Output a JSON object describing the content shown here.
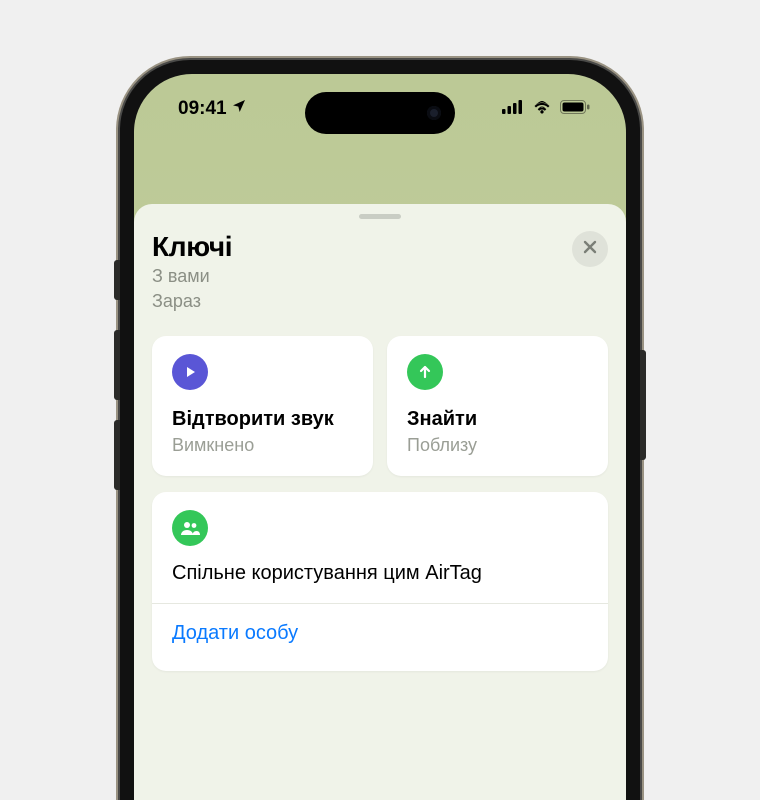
{
  "status": {
    "time": "09:41"
  },
  "sheet": {
    "title": "Ключі",
    "location": "З вами",
    "time": "Зараз"
  },
  "actions": {
    "play": {
      "title": "Відтворити звук",
      "sub": "Вимкнено"
    },
    "find": {
      "title": "Знайти",
      "sub": "Поблизу"
    }
  },
  "share": {
    "title": "Спільне користування цим AirTag",
    "add": "Додати особу"
  }
}
